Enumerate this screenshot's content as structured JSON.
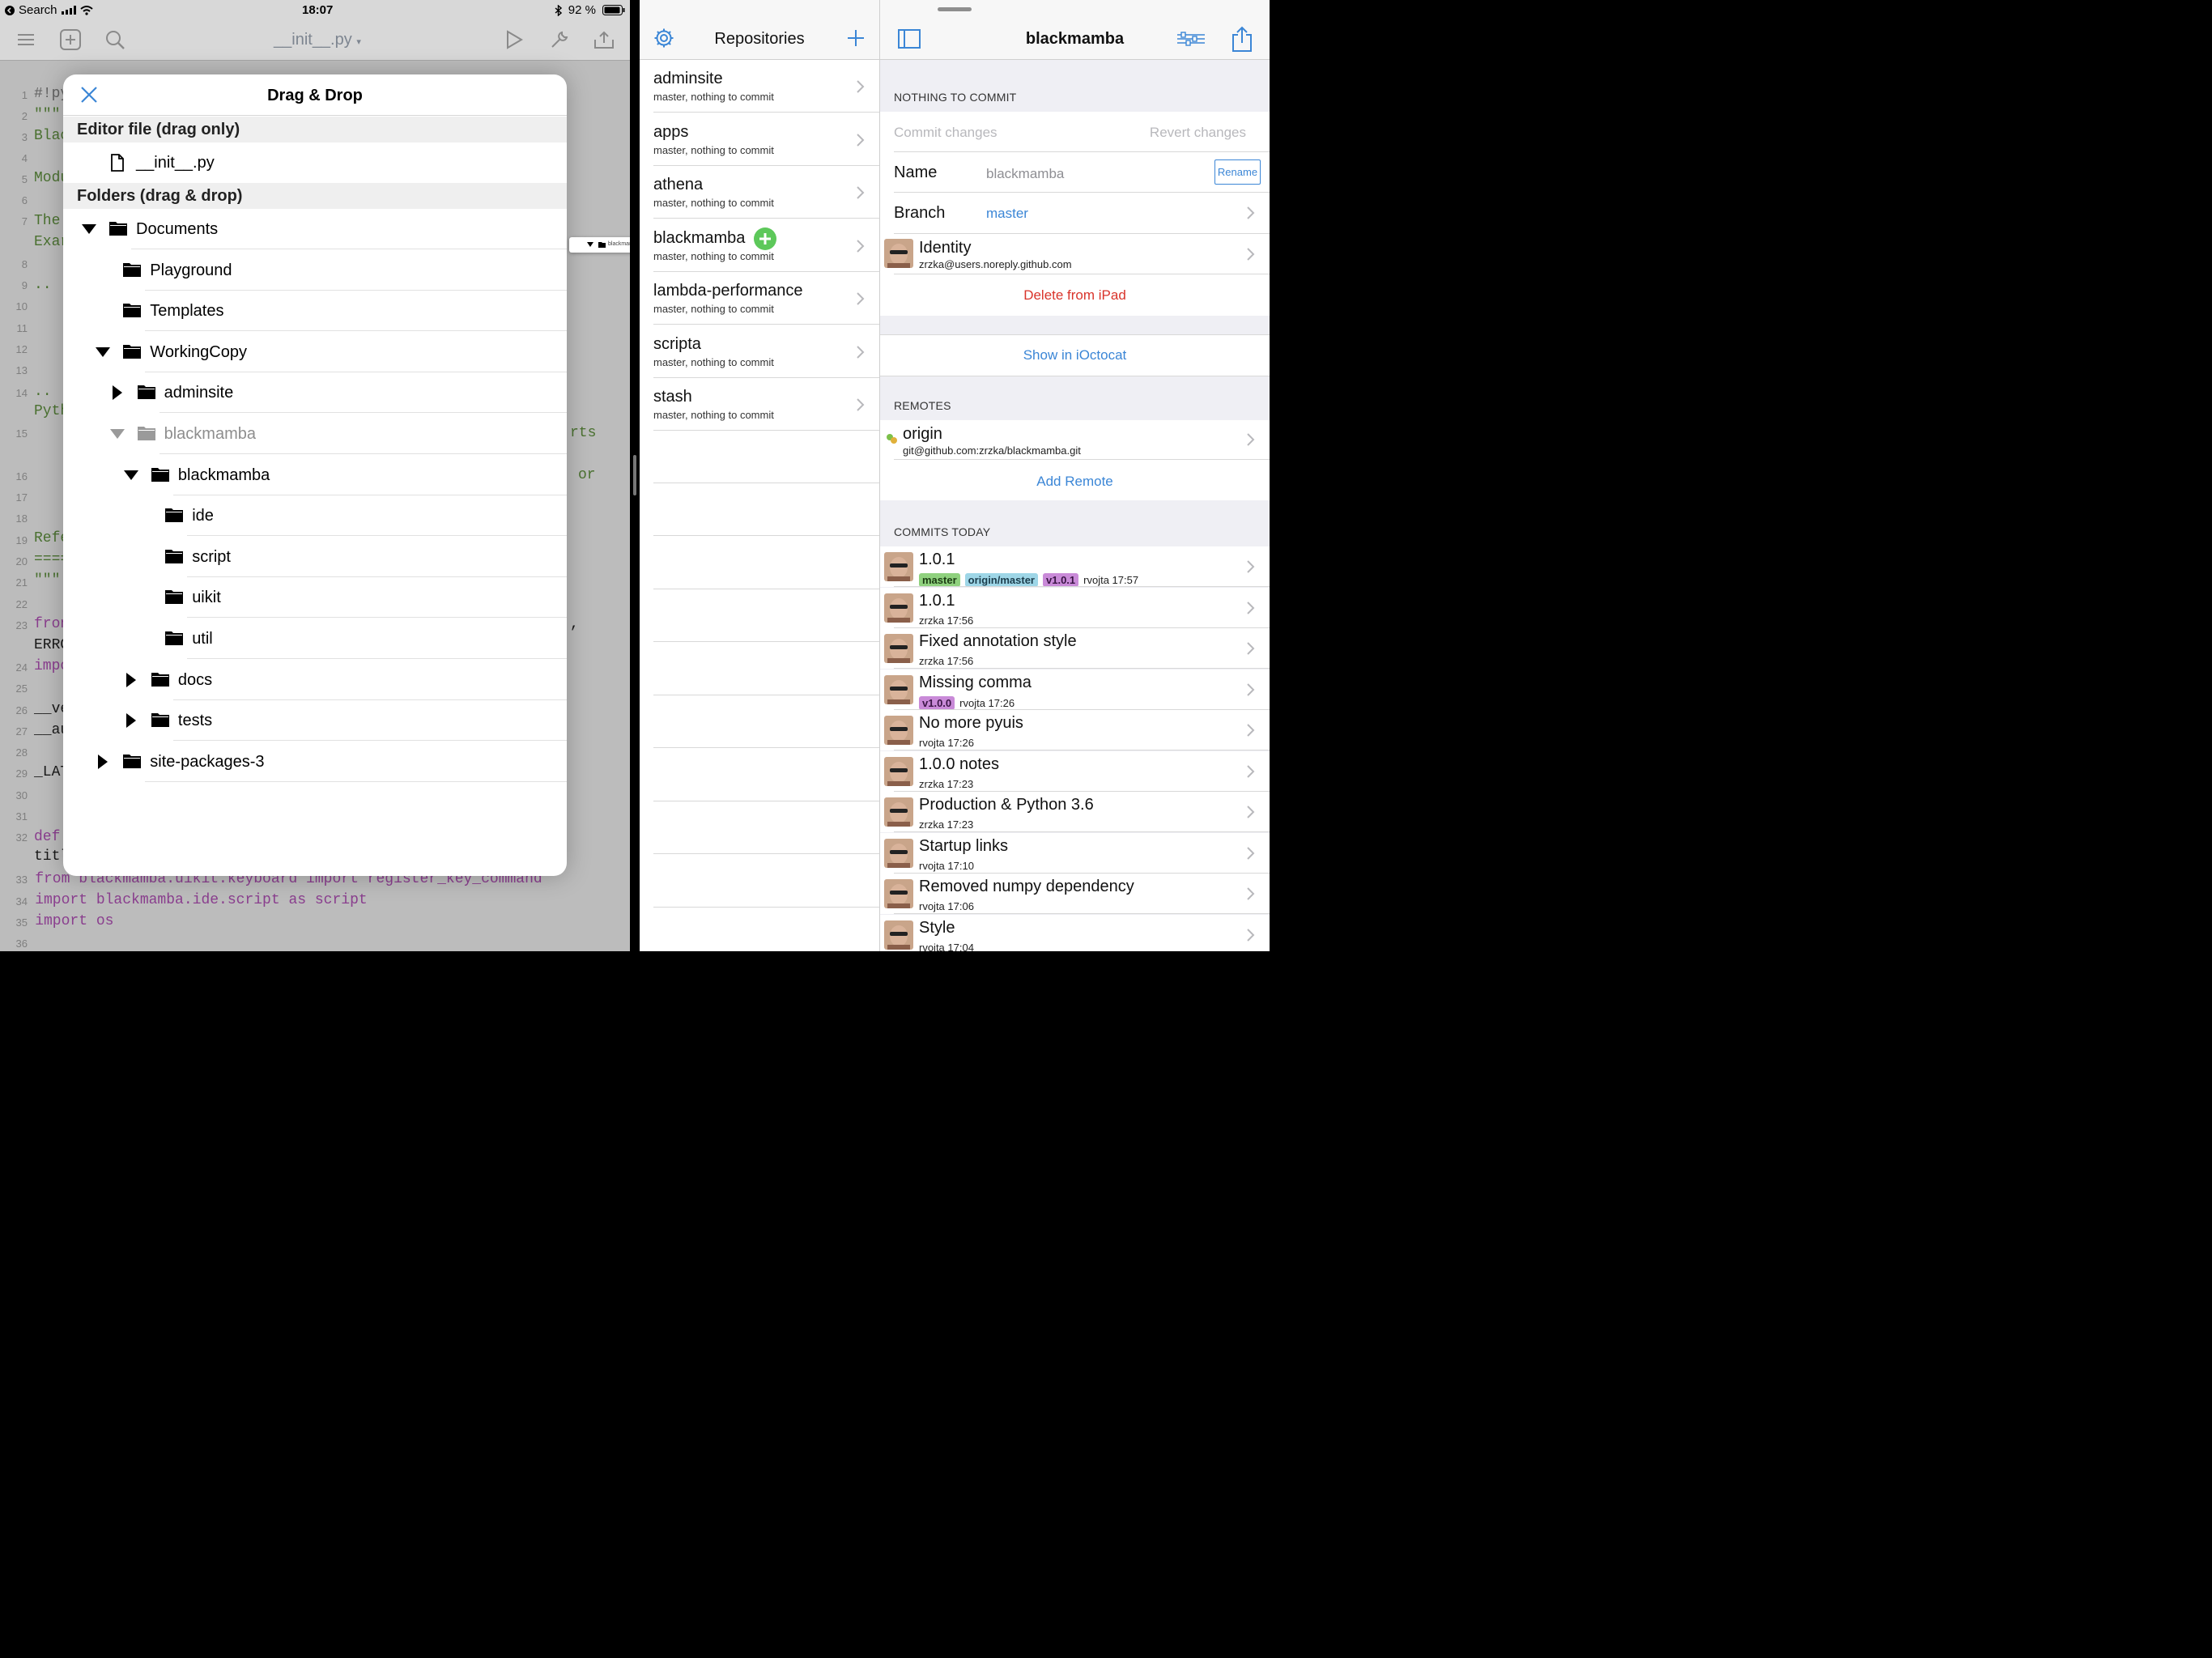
{
  "status_bar": {
    "back_label": "Search",
    "time": "18:07",
    "battery": "92 %"
  },
  "editor": {
    "file_name": "__init__.py",
    "line_numbers": [
      "1",
      "2",
      "3",
      "4",
      "5",
      "6",
      "7",
      "8",
      "9",
      "10",
      "11",
      "12",
      "13",
      "14",
      "15",
      "16",
      "17",
      "18",
      "19",
      "20",
      "21",
      "22",
      "23",
      "24",
      "25",
      "26",
      "27",
      "28",
      "29",
      "30",
      "31",
      "32",
      "33",
      "34",
      "35",
      "36"
    ],
    "visible_code": {
      "l1": "#!py",
      "l2": "\"\"\"",
      "l3": "Blac",
      "l5": "Modu",
      "l7": "The",
      "l7b": "Exar",
      "l9": "..  (",
      "l14": "..  v",
      "l14b": "Pyth",
      "l15r": "rts",
      "l16r": "or",
      "l19": "Refe",
      "l20": "====",
      "l21": "\"\"\"",
      "l23": "fron",
      "l23b": "ERRO",
      "l23r": ",",
      "l24": "impo",
      "l26": "__ve",
      "l27": "__au",
      "l29": "_LAT",
      "l32": "def",
      "l32b": "titl",
      "l33": "    from blackmamba.uikit.keyboard import register_key_command",
      "l34": "    import blackmamba.ide.script as script",
      "l35": "    import os"
    }
  },
  "modal": {
    "title": "Drag & Drop",
    "editor_section": "Editor file (drag only)",
    "editor_file": "__init__.py",
    "folders_section": "Folders (drag & drop)",
    "tree": [
      {
        "label": "Documents",
        "state": "expanded"
      },
      {
        "label": "Playground",
        "state": "leaf"
      },
      {
        "label": "Templates",
        "state": "leaf"
      },
      {
        "label": "WorkingCopy",
        "state": "expanded"
      },
      {
        "label": "adminsite",
        "state": "collapsed"
      },
      {
        "label": "blackmamba",
        "state": "expanded-dimmed"
      },
      {
        "label": "blackmamba",
        "state": "expanded"
      },
      {
        "label": "ide",
        "state": "leaf"
      },
      {
        "label": "script",
        "state": "leaf"
      },
      {
        "label": "uikit",
        "state": "leaf"
      },
      {
        "label": "util",
        "state": "leaf"
      },
      {
        "label": "docs",
        "state": "collapsed"
      },
      {
        "label": "tests",
        "state": "collapsed"
      },
      {
        "label": "site-packages-3",
        "state": "collapsed"
      }
    ]
  },
  "drag_preview": {
    "label": "blackmamba"
  },
  "repositories": {
    "title": "Repositories",
    "items": [
      {
        "name": "adminsite",
        "status": "master, nothing to commit"
      },
      {
        "name": "apps",
        "status": "master, nothing to commit"
      },
      {
        "name": "athena",
        "status": "master, nothing to commit"
      },
      {
        "name": "blackmamba",
        "status": "master, nothing to commit"
      },
      {
        "name": "lambda-performance",
        "status": "master, nothing to commit"
      },
      {
        "name": "scripta",
        "status": "master, nothing to commit"
      },
      {
        "name": "stash",
        "status": "master, nothing to commit"
      }
    ]
  },
  "detail": {
    "title": "blackmamba",
    "status_header": "NOTHING TO COMMIT",
    "commit_changes": "Commit changes",
    "revert_changes": "Revert changes",
    "name_label": "Name",
    "name_value": "blackmamba",
    "rename_label": "Rename",
    "branch_label": "Branch",
    "branch_value": "master",
    "identity_label": "Identity",
    "identity_email": "zrzka@users.noreply.github.com",
    "delete_label": "Delete from iPad",
    "show_label": "Show in iOctocat",
    "remotes_header": "REMOTES",
    "remote_name": "origin",
    "remote_url": "git@github.com:zrzka/blackmamba.git",
    "add_remote": "Add Remote",
    "commits_header": "COMMITS TODAY",
    "commits": [
      {
        "title": "1.0.1",
        "tags": [
          "master",
          "origin/master",
          "v1.0.1"
        ],
        "meta": "rvojta 17:57"
      },
      {
        "title": "1.0.1",
        "tags": [],
        "meta": "zrzka 17:56"
      },
      {
        "title": "Fixed annotation style",
        "tags": [],
        "meta": "zrzka 17:56"
      },
      {
        "title": "Missing comma",
        "tags": [
          "v1.0.0"
        ],
        "meta": "rvojta 17:26"
      },
      {
        "title": "No more pyuis",
        "tags": [],
        "meta": "rvojta 17:26"
      },
      {
        "title": "1.0.0 notes",
        "tags": [],
        "meta": "zrzka 17:23"
      },
      {
        "title": "Production & Python 3.6",
        "tags": [],
        "meta": "zrzka 17:23"
      },
      {
        "title": "Startup links",
        "tags": [],
        "meta": "rvojta 17:10"
      },
      {
        "title": "Removed numpy dependency",
        "tags": [],
        "meta": "rvojta 17:06"
      },
      {
        "title": "Style",
        "tags": [],
        "meta": "rvojta 17:04"
      }
    ]
  },
  "colors": {
    "accent": "#3b86d6",
    "destructive": "#d9342b",
    "add_badge": "#5dc85a",
    "code_purple": "#9b3fa0",
    "code_green": "#4e7d2e"
  }
}
